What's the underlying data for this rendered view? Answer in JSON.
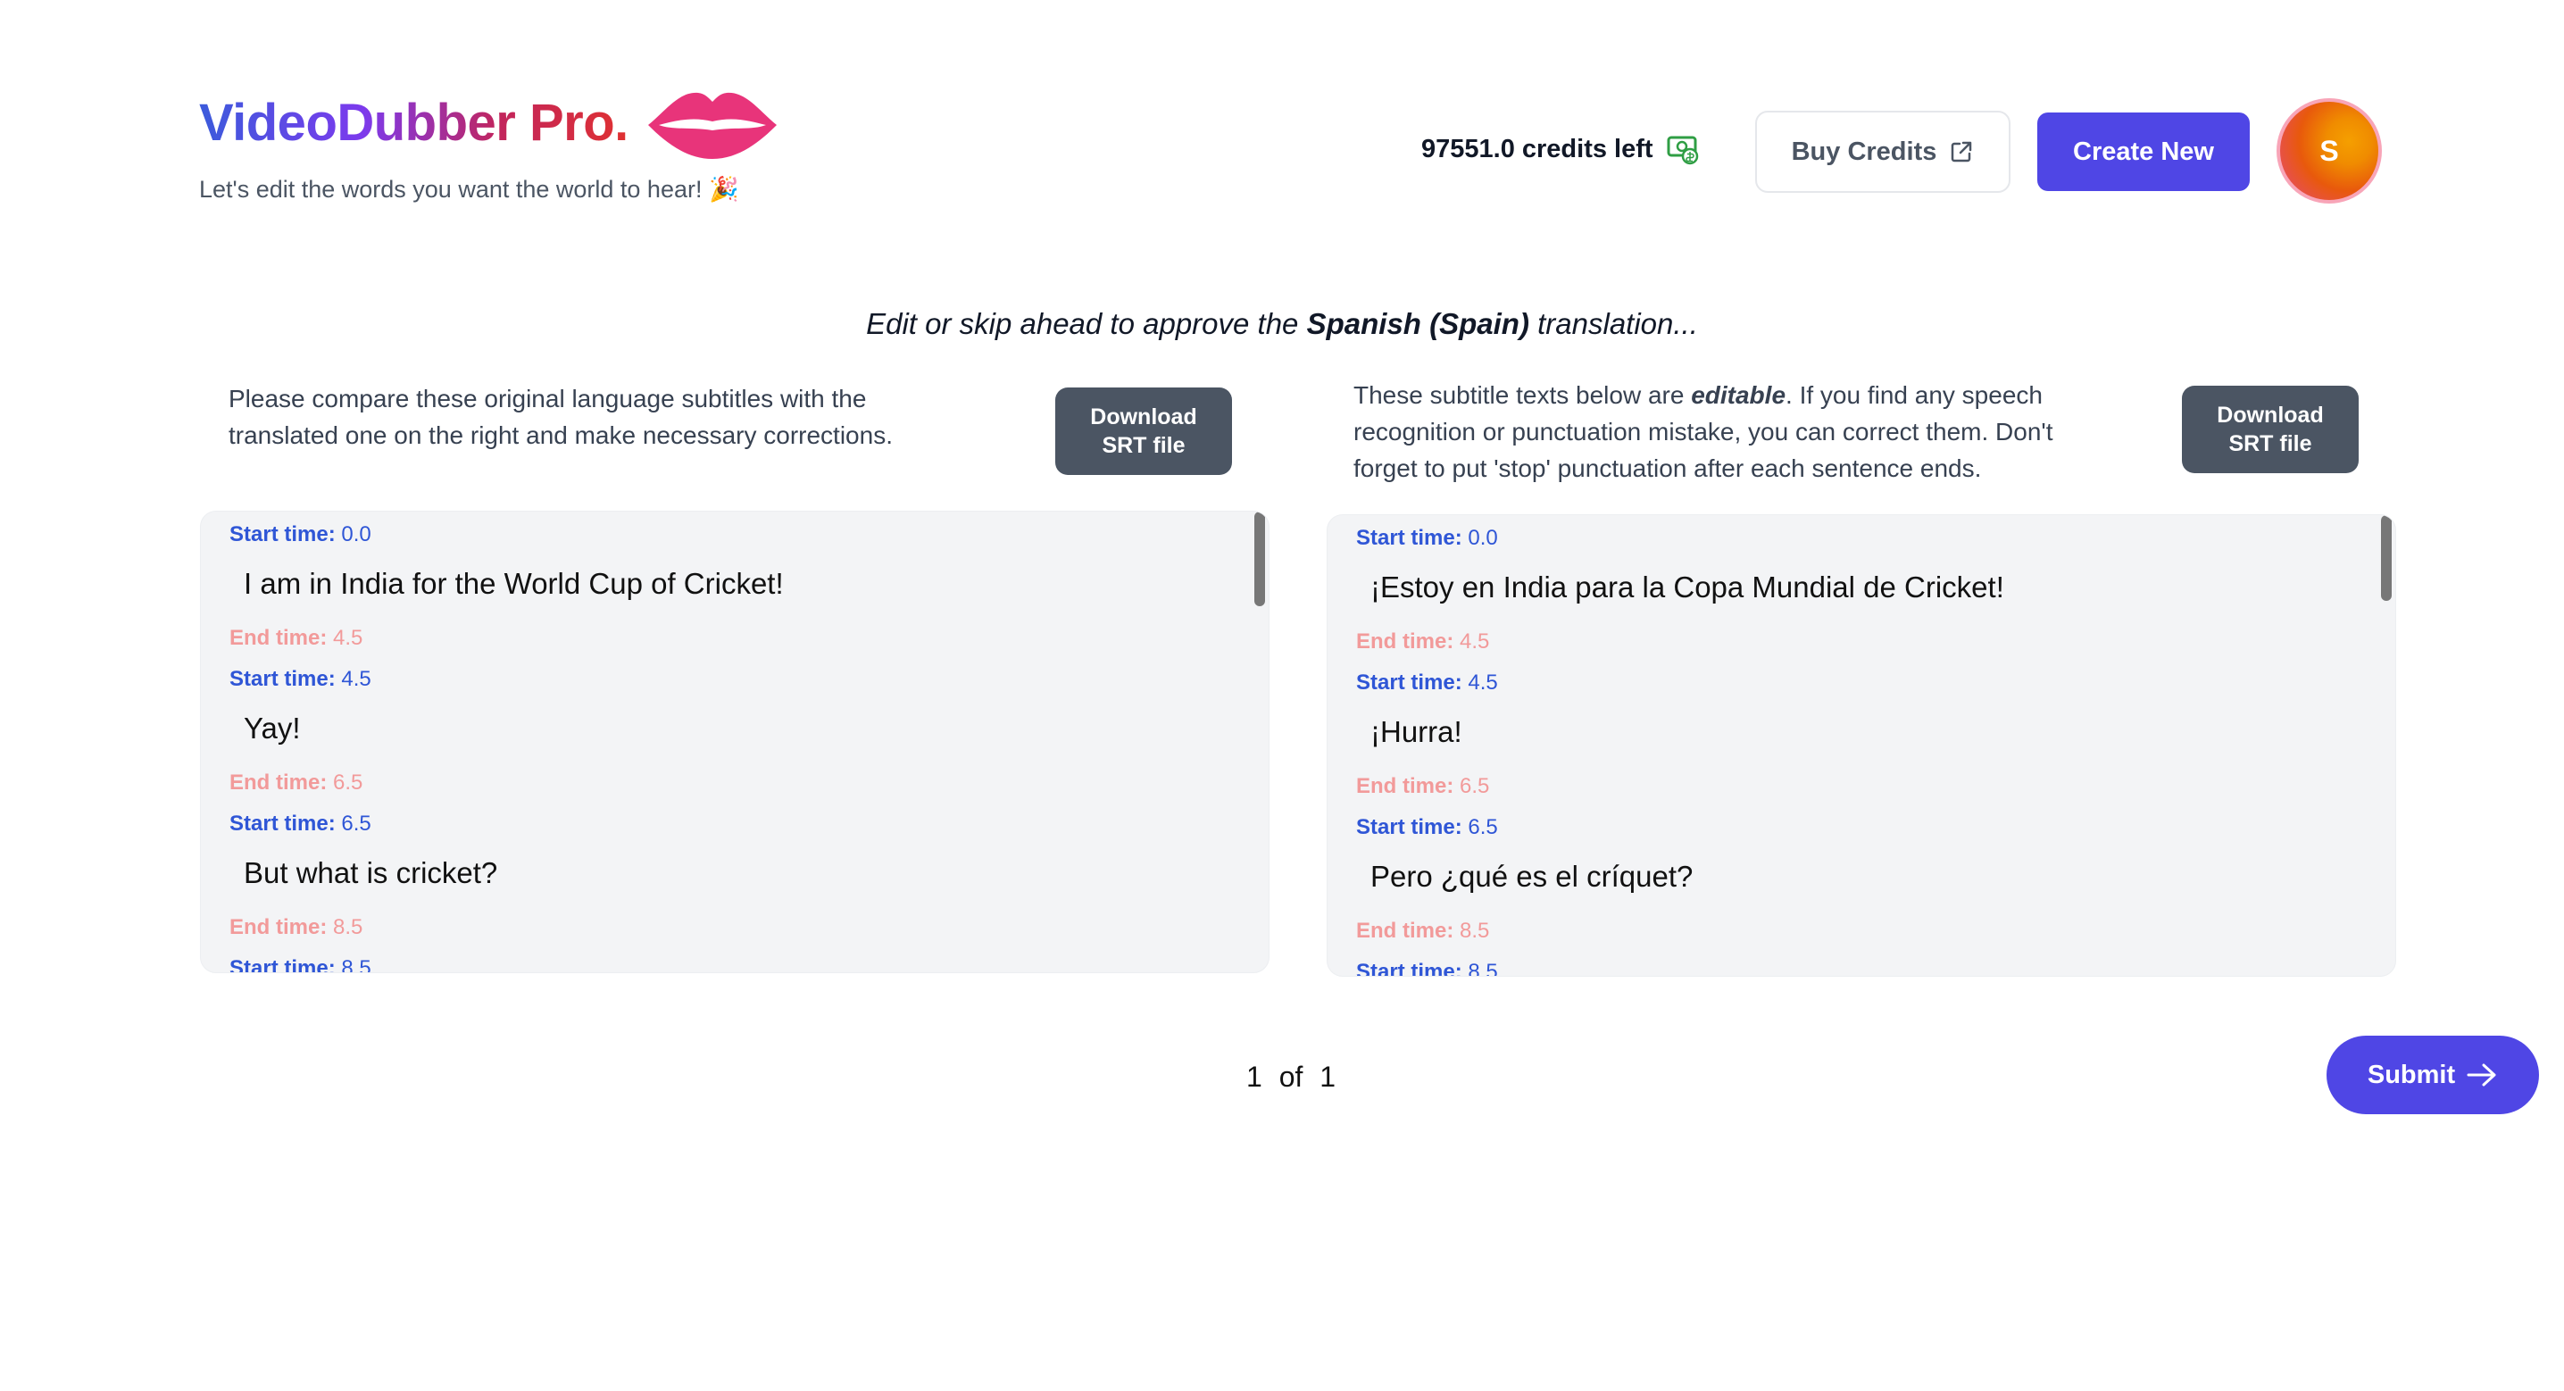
{
  "header": {
    "brand_name": "VideoDubber Pro.",
    "tagline": "Let's edit the words you want the world to hear! 🎉",
    "credits_text": "97551.0 credits left",
    "buy_credits_label": "Buy Credits",
    "create_new_label": "Create New",
    "avatar_initial": "S",
    "brand_icon": "lips-icon",
    "accent_color": "#4f46e5"
  },
  "instruction": {
    "prefix": "Edit or skip ahead to approve the ",
    "language": "Spanish (Spain)",
    "suffix": " translation..."
  },
  "left_panel": {
    "description": "Please compare these original language subtitles with the translated one on the right and make necessary corrections.",
    "download_line1": "Download",
    "download_line2": "SRT file",
    "entries": [
      {
        "start": "0.0",
        "text": "I am in India for the World Cup of Cricket!",
        "end": "4.5"
      },
      {
        "start": "4.5",
        "text": "Yay!",
        "end": "6.5"
      },
      {
        "start": "6.5",
        "text": "But what is cricket?",
        "end": "8.5"
      },
      {
        "start": "8.5",
        "text": "",
        "end": ""
      }
    ]
  },
  "right_panel": {
    "description_prefix": "These subtitle texts below are ",
    "description_emphasis": "editable",
    "description_suffix": ". If you find any speech recognition or punctuation mistake, you can correct them. Don't forget to put 'stop' punctuation after each sentence ends.",
    "download_line1": "Download",
    "download_line2": "SRT file",
    "entries": [
      {
        "start": "0.0",
        "text": "¡Estoy en India para la Copa Mundial de Cricket!",
        "end": "4.5"
      },
      {
        "start": "4.5",
        "text": "¡Hurra!",
        "end": "6.5"
      },
      {
        "start": "6.5",
        "text": "Pero ¿qué es el críquet?",
        "end": "8.5"
      },
      {
        "start": "8.5",
        "text": "",
        "end": ""
      }
    ]
  },
  "labels": {
    "start_time": "Start time:",
    "end_time": "End time:"
  },
  "pagination": {
    "current": "1",
    "separator": "of",
    "total": "1"
  },
  "submit_label": "Submit"
}
